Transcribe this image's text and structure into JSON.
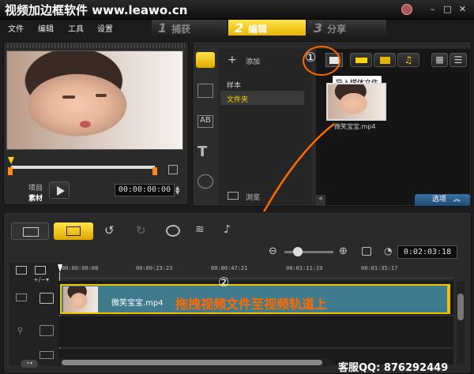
{
  "window": {
    "title": "视频加边框软件 www.leawo.cn"
  },
  "menu": [
    "文件",
    "编辑",
    "工具",
    "设置"
  ],
  "steps": [
    {
      "num": "1",
      "label": "捕获"
    },
    {
      "num": "2",
      "label": "编辑"
    },
    {
      "num": "3",
      "label": "分享"
    }
  ],
  "player": {
    "project_label": "项目",
    "clip_label": "素材",
    "timecode": "00:00:00:00"
  },
  "library": {
    "add_label": "添加",
    "folders": [
      "样本",
      "文件夹"
    ],
    "browse_label": "浏览",
    "import_tooltip": "导入媒体文件",
    "thumb_filename": "微笑宝宝.mp4",
    "options_label": "选项",
    "callout_1": "①"
  },
  "timeline": {
    "duration": "0:02:03:18",
    "ruler": [
      "00:00:00:00",
      "00:00:23:23",
      "00:00:47:21",
      "00:01:11:19",
      "00:01:35:17"
    ],
    "clip_name": "微笑宝宝.mp4",
    "callout_2": "②",
    "instruction": "拖拽视频文件至视频轨道上"
  },
  "footer": {
    "service_label": "客服QQ: 876292449"
  },
  "colors": {
    "accent": "#f2c200",
    "orange": "#ff6a00",
    "selection": "#3a3a3a"
  }
}
